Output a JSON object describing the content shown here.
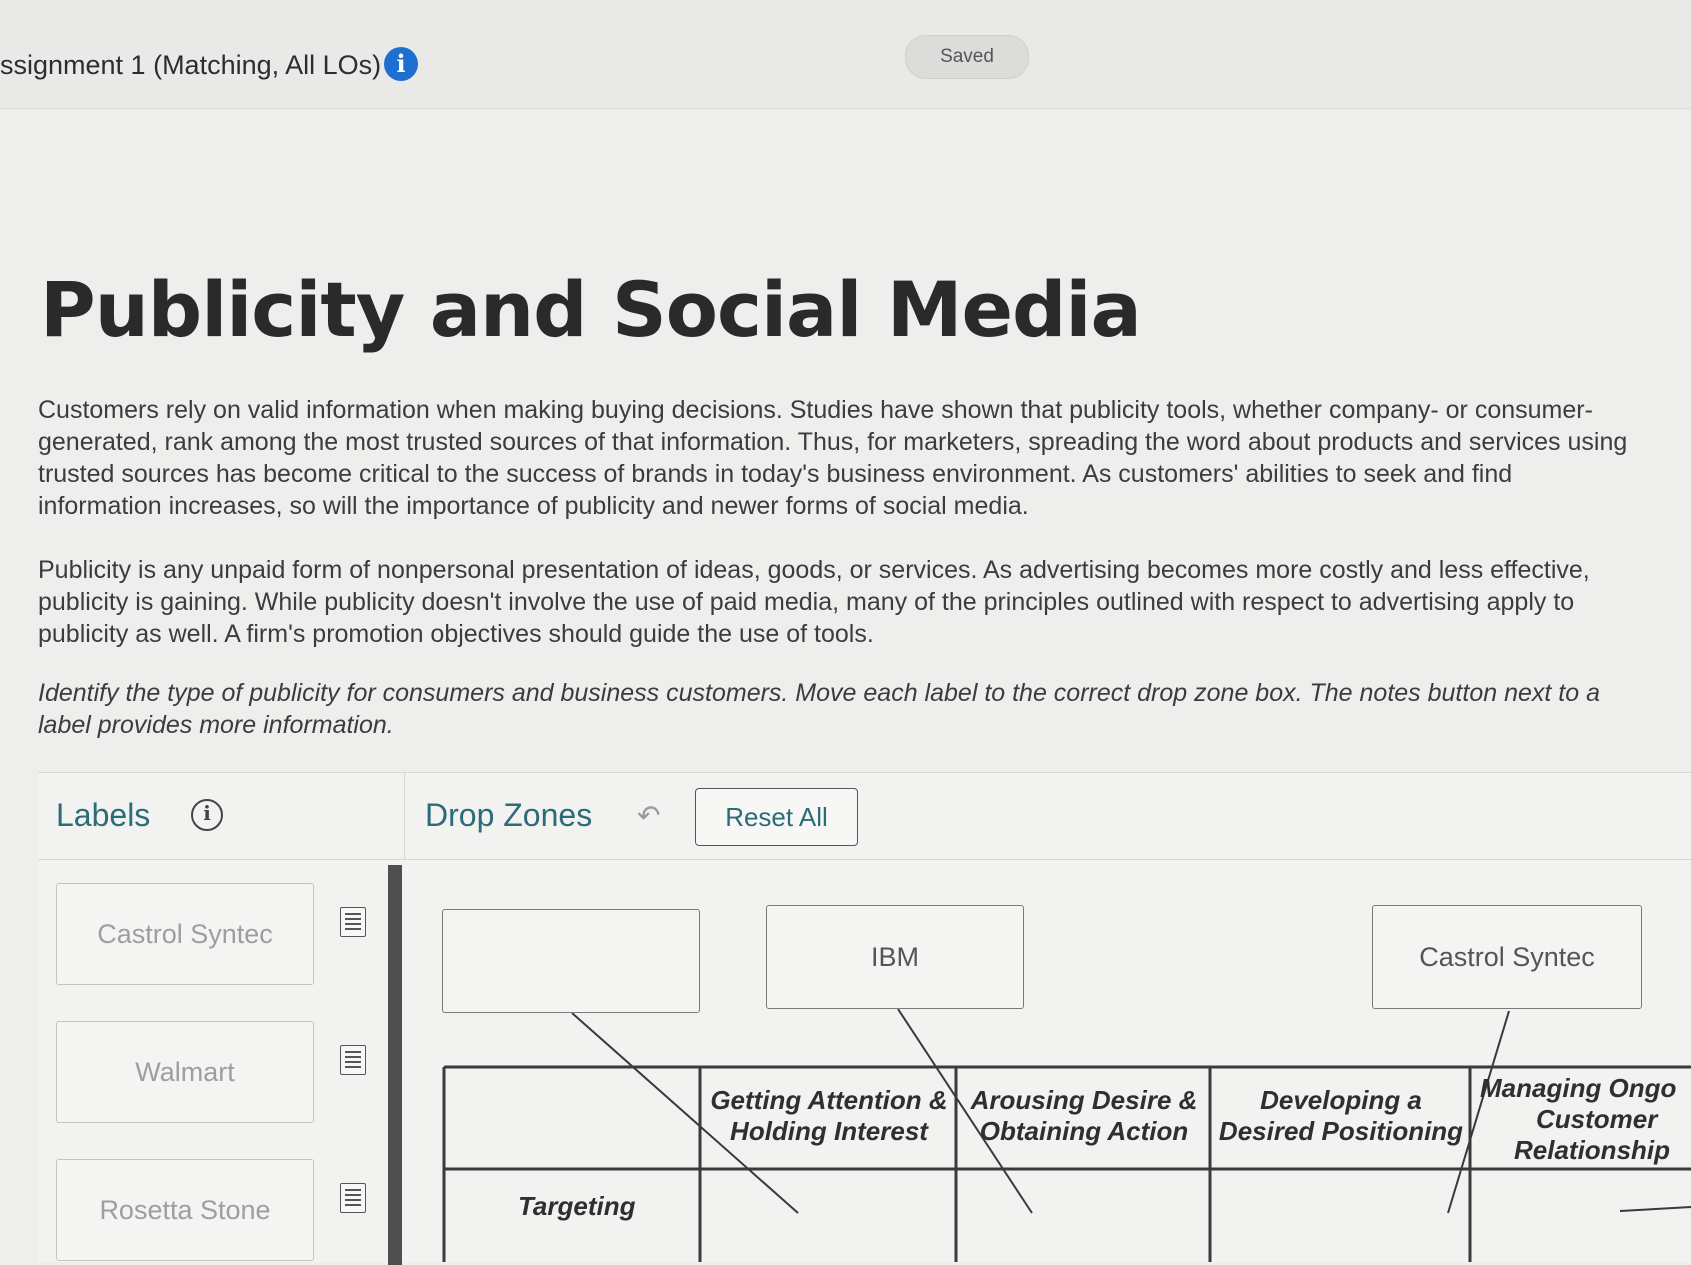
{
  "header": {
    "assignment_title": "ssignment 1 (Matching, All LOs)",
    "info_glyph": "i",
    "saved_label": "Saved"
  },
  "main": {
    "title": "Publicity and Social Media",
    "paragraph1": "Customers rely on valid information when making buying decisions. Studies have shown that publicity tools, whether company- or consumer-generated, rank among the most trusted sources of that information. Thus, for marketers, spreading the word about products and services using trusted sources has become critical to the success of brands in today's business environment. As customers' abilities to seek and find information increases, so will the importance of publicity and newer forms of social media.",
    "paragraph2": "Publicity is any unpaid form of nonpersonal presentation of ideas, goods, or services. As advertising becomes more costly and less effective, publicity is gaining. While publicity doesn't involve the use of paid media, many of the principles outlined with respect to advertising apply to publicity as well. A firm's promotion objectives should guide the use of tools.",
    "instructions": "Identify the type of publicity for consumers and business customers. Move each label to the correct drop zone box. The notes button next to a label provides more information."
  },
  "labels_panel": {
    "title": "Labels",
    "info_glyph": "i",
    "items": [
      {
        "label": "Castrol Syntec"
      },
      {
        "label": "Walmart"
      },
      {
        "label": "Rosetta Stone"
      }
    ]
  },
  "drop_zones": {
    "title": "Drop Zones",
    "reset_label": "Reset All",
    "zones": [
      {
        "value": ""
      },
      {
        "value": "IBM"
      },
      {
        "value": "Castrol Syntec"
      }
    ],
    "columns": [
      {
        "line1": "Getting Attention &",
        "line2": "Holding Interest",
        "line3": ""
      },
      {
        "line1": "Arousing Desire &",
        "line2": "Obtaining Action",
        "line3": ""
      },
      {
        "line1": "Developing a",
        "line2": "Desired Positioning",
        "line3": ""
      },
      {
        "line1": "Managing Ongo",
        "line2": "Customer",
        "line3": "Relationship"
      }
    ],
    "row_header": "Targeting"
  }
}
